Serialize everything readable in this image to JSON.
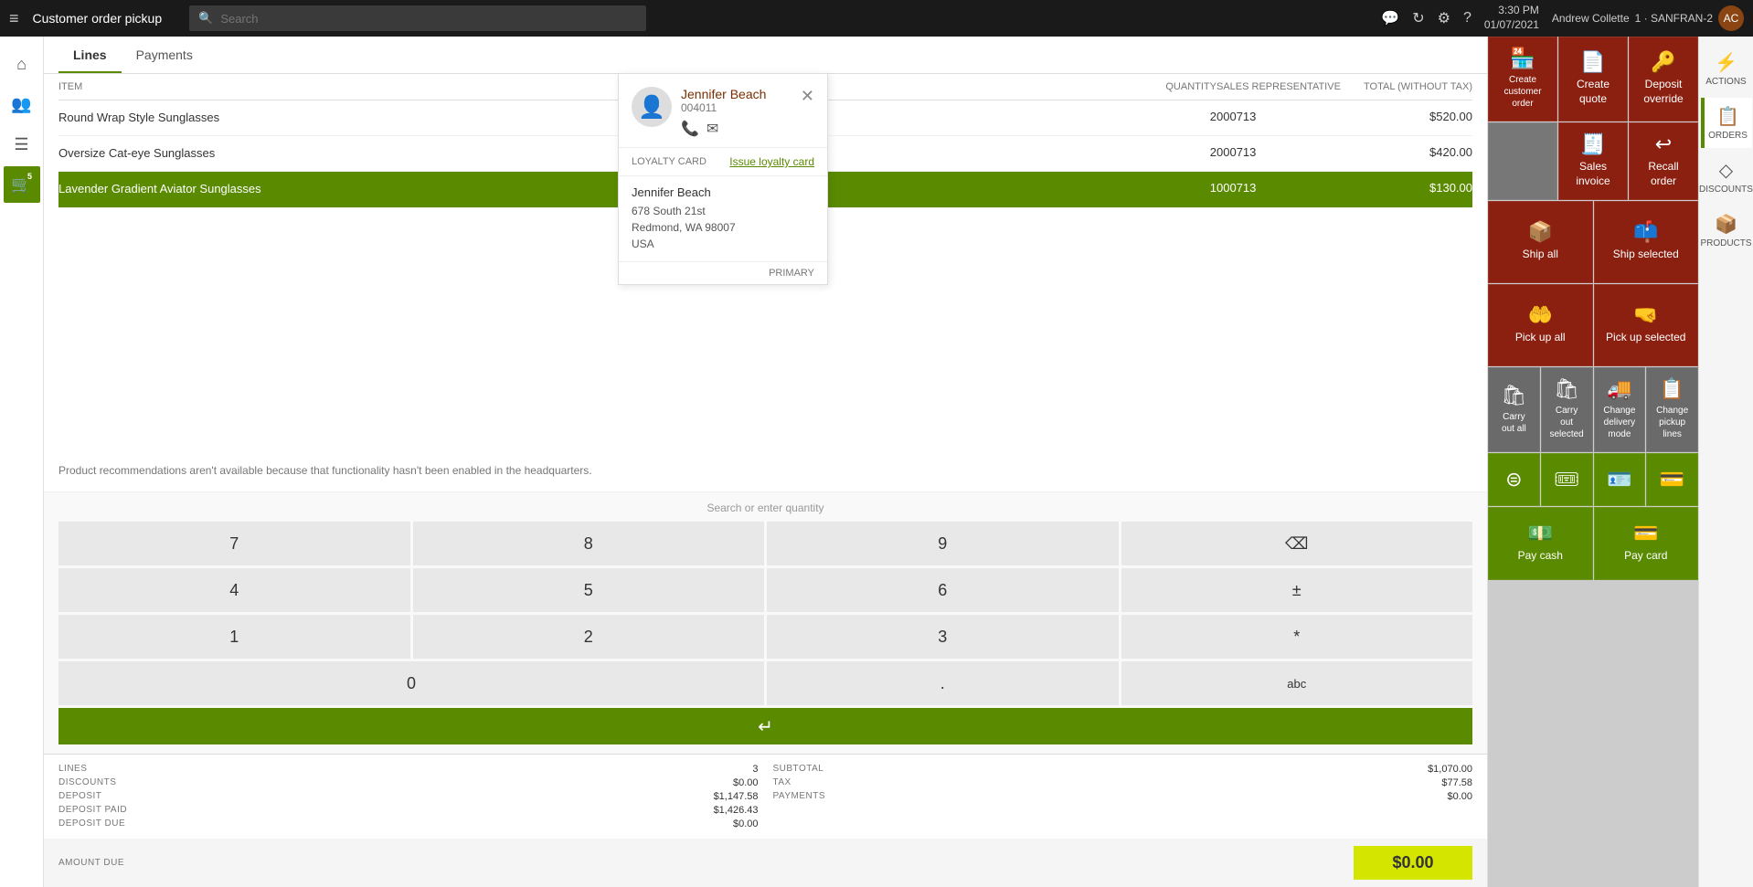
{
  "topbar": {
    "hamburger": "≡",
    "title": "Customer order pickup",
    "search_placeholder": "Search",
    "time": "3:30 PM",
    "date": "01/07/2021",
    "store": "1 · SANFRAN-2",
    "user": "Andrew Collette",
    "avatar_initials": "AC"
  },
  "tabs": {
    "lines": "Lines",
    "payments": "Payments"
  },
  "table": {
    "headers": {
      "item": "ITEM",
      "quantity": "QUANTITY",
      "sales_rep": "SALES REPRESENTATIVE",
      "total": "TOTAL (WITHOUT TAX)"
    },
    "rows": [
      {
        "item": "Round Wrap Style Sunglasses",
        "quantity": "2",
        "sales_rep": "000713",
        "total": "$520.00",
        "selected": false
      },
      {
        "item": "Oversize Cat-eye Sunglasses",
        "quantity": "2",
        "sales_rep": "000713",
        "total": "$420.00",
        "selected": false
      },
      {
        "item": "Lavender Gradient Aviator Sunglasses",
        "quantity": "1",
        "sales_rep": "000713",
        "total": "$130.00",
        "selected": true
      }
    ]
  },
  "recommendation": "Product recommendations aren't available because that functionality hasn't been enabled in the headquarters.",
  "numpad": {
    "search_qty_label": "Search or enter quantity",
    "keys": [
      "7",
      "8",
      "9",
      "⌫",
      "4",
      "5",
      "6",
      "±",
      "1",
      "2",
      "3",
      "*",
      "0",
      ".",
      "abc",
      "↵"
    ]
  },
  "summary": {
    "lines_label": "LINES",
    "lines_value": "3",
    "discounts_label": "DISCOUNTS",
    "discounts_value": "$0.00",
    "deposit_label": "DEPOSIT",
    "deposit_value": "$1,147.58",
    "deposit_paid_label": "DEPOSIT PAID",
    "deposit_paid_value": "$1,426.43",
    "deposit_due_label": "DEPOSIT DUE",
    "deposit_due_value": "$0.00",
    "subtotal_label": "SUBTOTAL",
    "subtotal_value": "$1,070.00",
    "tax_label": "TAX",
    "tax_value": "$77.58",
    "payments_label": "PAYMENTS",
    "payments_value": "$0.00",
    "amount_due_label": "AMOUNT DUE",
    "amount_due_value": "$0.00"
  },
  "customer": {
    "name": "Jennifer Beach",
    "id": "004011",
    "loyalty_card_label": "LOYALTY CARD",
    "loyalty_card_action": "Issue loyalty card",
    "address_name": "Jennifer Beach",
    "address_line1": "678 South 21st",
    "address_line2": "Redmond, WA 98007",
    "address_line3": "USA",
    "primary_label": "PRIMARY"
  },
  "action_buttons": {
    "create_customer_order": "Create customer order",
    "create_quote": "Create quote",
    "deposit_override": "Deposit override",
    "sales_invoice": "Sales invoice",
    "recall_order": "Recall order",
    "ship_all": "Ship all",
    "ship_selected": "Ship selected",
    "pick_up_all": "Pick up all",
    "pick_up_selected": "Pick up selected",
    "carry_out_all": "Carry out all",
    "carry_out_selected": "Carry out selected",
    "change_delivery_mode": "Change delivery mode",
    "change_pickup_lines": "Change pickup lines",
    "pay_cash": "Pay cash",
    "pay_card": "Pay card",
    "actions_label": "ACTIONS",
    "orders_label": "ORDERS",
    "discounts_label": "DISCOUNTS",
    "products_label": "PRODUCTS"
  },
  "icons": {
    "search": "🔍",
    "home": "⌂",
    "group": "👥",
    "list": "≡",
    "cart": "🛒",
    "tag": "🏷",
    "comment": "💬",
    "refresh": "↻",
    "settings": "⚙",
    "help": "?",
    "action": "⚡",
    "orders": "📋",
    "discounts": "◇",
    "products": "📦",
    "ship": "📦",
    "pickup": "🤲",
    "carry": "🛍",
    "payment": "💳",
    "cash": "💵"
  }
}
